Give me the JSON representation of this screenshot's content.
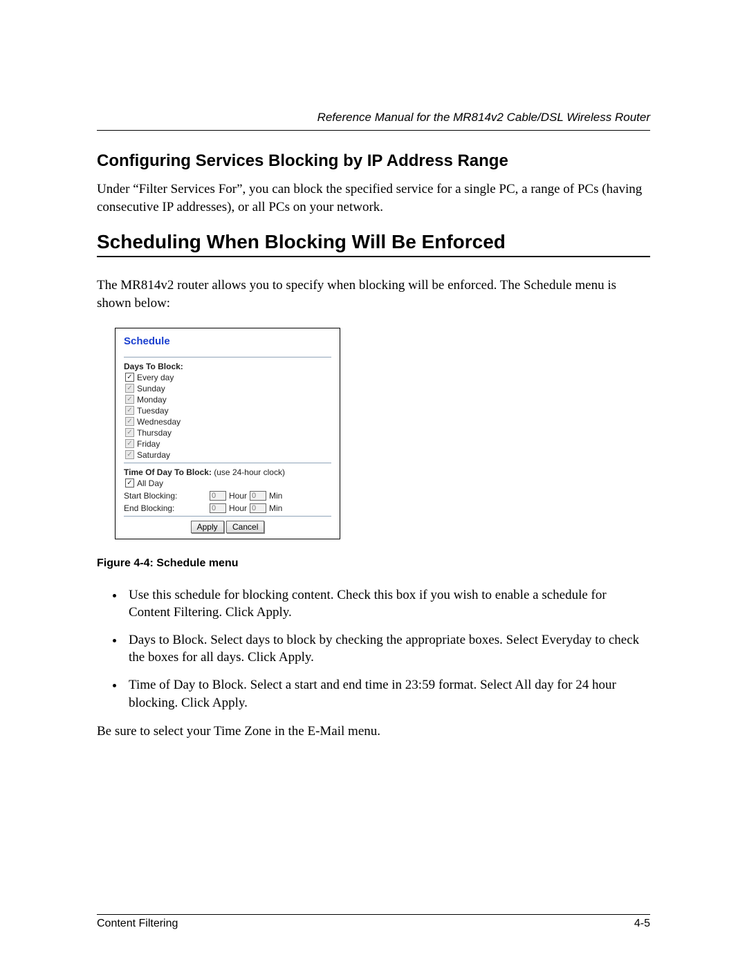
{
  "header": {
    "running_title": "Reference Manual for the MR814v2 Cable/DSL Wireless Router"
  },
  "section1": {
    "title": "Configuring Services Blocking by IP Address Range",
    "para": "Under “Filter Services For”, you can block the specified service for a single PC, a range of PCs (having consecutive IP addresses), or all PCs on your network."
  },
  "section2": {
    "title": "Scheduling When Blocking Will Be Enforced",
    "intro": "The MR814v2 router allows you to specify when blocking will be enforced. The Schedule menu is shown below:"
  },
  "schedule_panel": {
    "title": "Schedule",
    "days_label": "Days To Block:",
    "days": [
      {
        "label": "Every day",
        "checked": true,
        "disabled": false
      },
      {
        "label": "Sunday",
        "checked": true,
        "disabled": true
      },
      {
        "label": "Monday",
        "checked": true,
        "disabled": true
      },
      {
        "label": "Tuesday",
        "checked": true,
        "disabled": true
      },
      {
        "label": "Wednesday",
        "checked": true,
        "disabled": true
      },
      {
        "label": "Thursday",
        "checked": true,
        "disabled": true
      },
      {
        "label": "Friday",
        "checked": true,
        "disabled": true
      },
      {
        "label": "Saturday",
        "checked": true,
        "disabled": true
      }
    ],
    "tod_label": "Time Of Day To Block:",
    "tod_note": "(use 24-hour clock)",
    "all_day_label": "All Day",
    "start_label": "Start Blocking:",
    "end_label": "End Blocking:",
    "hour_label": "Hour",
    "min_label": "Min",
    "start_hour": "0",
    "start_min": "0",
    "end_hour": "0",
    "end_min": "0",
    "apply_btn": "Apply",
    "cancel_btn": "Cancel"
  },
  "figure_caption": "Figure 4-4:  Schedule menu",
  "bullets": [
    "Use this schedule for blocking content. Check this box if you wish to enable a schedule for Content Filtering. Click Apply.",
    "Days to Block. Select days to block by checking the appropriate boxes. Select Everyday to check the boxes for all days. Click Apply.",
    "Time of Day to Block. Select a start and end time in 23:59 format. Select All day for 24 hour blocking. Click Apply."
  ],
  "closing": "Be sure to select your Time Zone in the E-Mail menu.",
  "footer": {
    "left": "Content Filtering",
    "right": "4-5"
  }
}
